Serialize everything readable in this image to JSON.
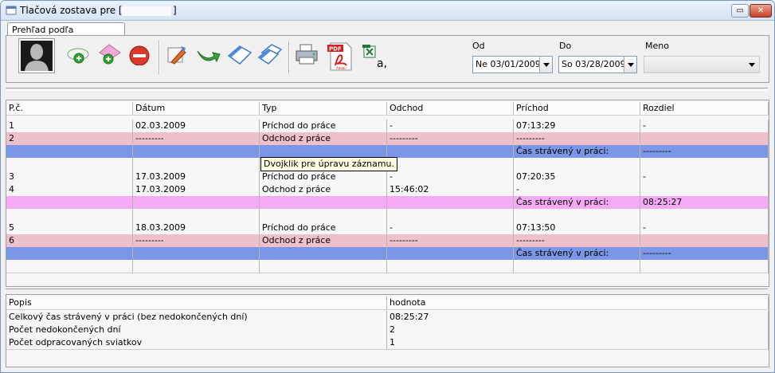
{
  "window": {
    "title": "Tlačová zostava pre [",
    "title_end": "]",
    "restore_glyph": "▭",
    "close_glyph": "✕"
  },
  "tab": {
    "label": "Prehľad podľa zamestnanca"
  },
  "filters": {
    "from_label": "Od",
    "to_label": "Do",
    "name_label": "Meno",
    "from_value": "Ne 03/01/2009",
    "to_value": "So 03/28/2009",
    "name_value": ""
  },
  "toolbar": {
    "icons": [
      "person-photo-icon",
      "add-record-icon",
      "add-pink-record-icon",
      "delete-icon",
      "edit-icon",
      "forward-arrow-icon",
      "blank-document-icon",
      "copy-documents-icon",
      "print-icon",
      "pdf-export-icon",
      "excel-export-icon"
    ]
  },
  "colors": {
    "pink": "#eec0cc",
    "blue": "#7a96e6",
    "magenta": "#f4aaf4",
    "row": "#f6f6f6"
  },
  "records": {
    "headers": [
      "P.č.",
      "Dátum",
      "Typ",
      "Odchod",
      "Príchod",
      "Rozdiel"
    ],
    "rows": [
      {
        "style": "plain",
        "cells": [
          "1",
          "02.03.2009",
          "Príchod do práce",
          "-",
          "07:13:29",
          "-"
        ]
      },
      {
        "style": "pink",
        "cells": [
          "2",
          "---------",
          "Odchod z práce",
          "---------",
          "---------",
          ""
        ]
      },
      {
        "style": "blue",
        "cells": [
          "",
          "",
          "",
          "",
          "Čas strávený v práci:",
          "---------"
        ]
      },
      {
        "style": "plain",
        "cells": [
          "",
          "",
          "",
          "",
          "",
          ""
        ]
      },
      {
        "style": "plain",
        "cells": [
          "3",
          "17.03.2009",
          "Príchod do práce",
          "-",
          "07:20:35",
          "-"
        ]
      },
      {
        "style": "plain",
        "cells": [
          "4",
          "17.03.2009",
          "Odchod z práce",
          "15:46:02",
          "-",
          ""
        ]
      },
      {
        "style": "magenta",
        "cells": [
          "",
          "",
          "",
          "",
          "Čas strávený v práci:",
          "08:25:27"
        ]
      },
      {
        "style": "plain",
        "cells": [
          "",
          "",
          "",
          "",
          "",
          ""
        ]
      },
      {
        "style": "plain",
        "cells": [
          "5",
          "18.03.2009",
          "Príchod do práce",
          "-",
          "07:13:50",
          "-"
        ]
      },
      {
        "style": "pink",
        "cells": [
          "6",
          "---------",
          "Odchod z práce",
          "---------",
          "---------",
          ""
        ]
      },
      {
        "style": "blue",
        "cells": [
          "",
          "",
          "",
          "",
          "Čas strávený v práci:",
          "---------"
        ]
      },
      {
        "style": "plain",
        "cells": [
          "",
          "",
          "",
          "",
          "",
          ""
        ]
      }
    ],
    "tooltip": "Dvojklik pre úpravu záznamu."
  },
  "summary": {
    "headers": [
      "Popis",
      "hodnota"
    ],
    "rows": [
      [
        "Celkový čas strávený v práci (bez nedokončených dní)",
        "08:25:27"
      ],
      [
        "Počet nedokončených dní",
        "2"
      ],
      [
        "Počet odpracovaných sviatkov",
        "1"
      ]
    ]
  }
}
